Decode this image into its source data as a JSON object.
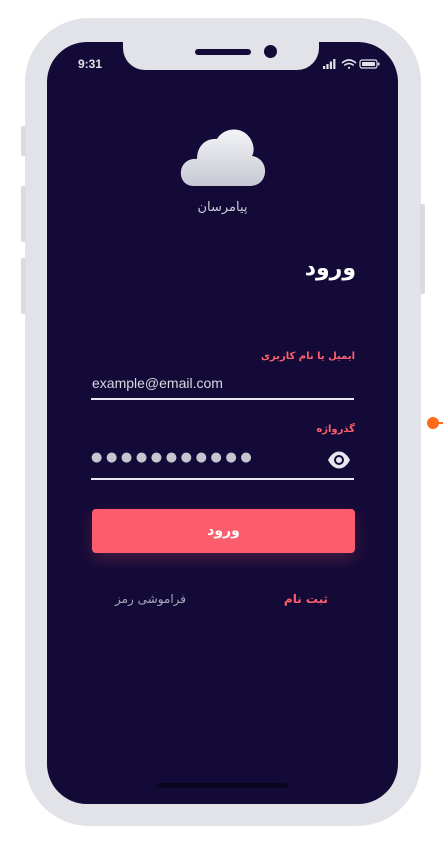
{
  "status_bar": {
    "time": "9:31"
  },
  "app": {
    "name": "پیامرسان"
  },
  "login": {
    "title": "ورود",
    "email": {
      "label": "ایمیل یا نام کاربری",
      "placeholder": "example@email.com"
    },
    "password": {
      "label": "گذرواژه",
      "masked_value": "●●●●●●●●●●●"
    },
    "submit_label": "ورود",
    "signup_label": "ثبت نام",
    "forgot_label": "فراموشی رمز"
  },
  "icons": {
    "logo": "cloud-icon",
    "status": [
      "signal-icon",
      "wifi-icon",
      "battery-icon"
    ],
    "password_toggle": "eye-icon"
  },
  "colors": {
    "background": "#140a38",
    "accent": "#fb5d6d",
    "label": "#ff5f6d",
    "frame": "#e1e3e8"
  }
}
